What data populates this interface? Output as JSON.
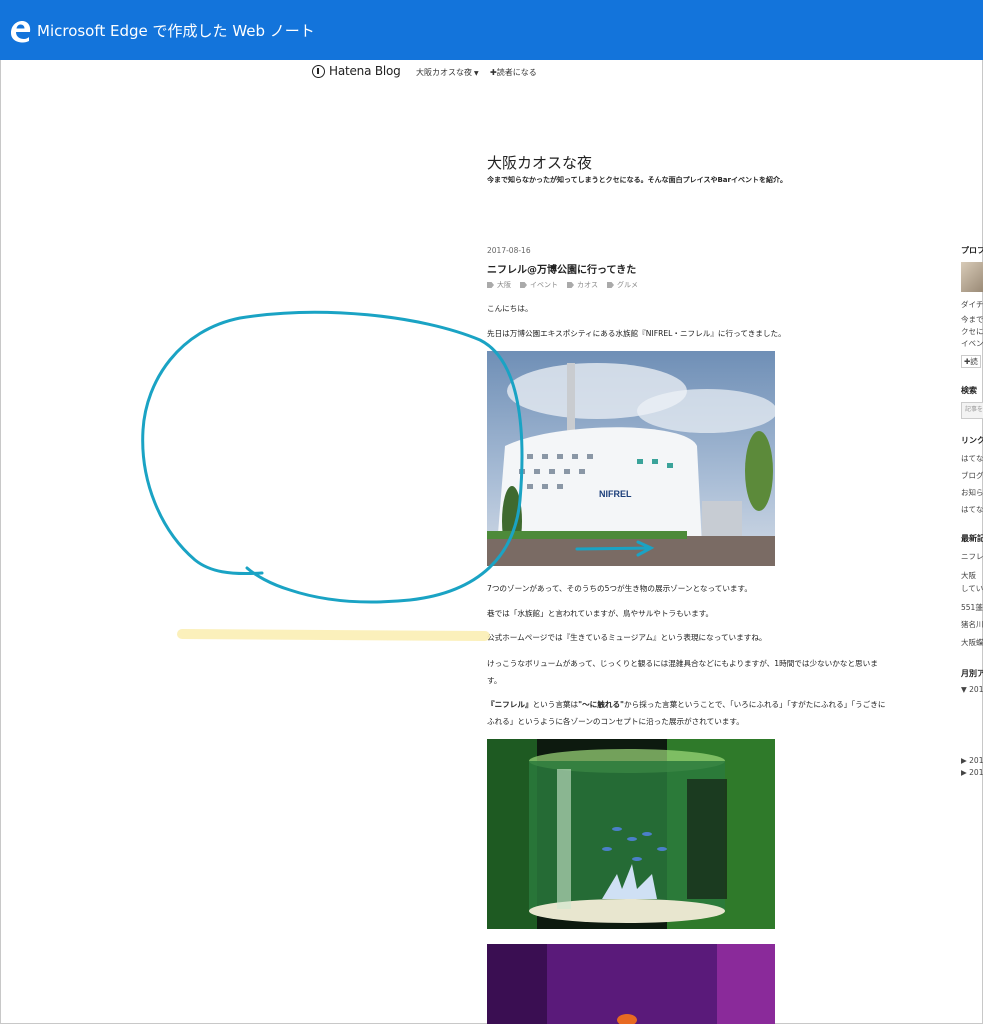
{
  "edge": {
    "title": "Microsoft Edge で作成した Web ノート",
    "logo_icon": "edge-logo-icon",
    "accent": "#1374db"
  },
  "hatena": {
    "logo_text": "Hatena Blog",
    "blog_menu": "大阪カオスな夜",
    "reader_button": "読者になる"
  },
  "blog": {
    "title": "大阪カオスな夜",
    "description": "今まで知らなかったが知ってしまうとクセになる。そんな面白プレイスやBarイベントを紹介。"
  },
  "post": {
    "date": "2017-08-16",
    "title": "ニフレル@万博公園に行ってきた",
    "tags": [
      "大阪",
      "イベント",
      "カオス",
      "グルメ"
    ],
    "p1": "こんにちは。",
    "p2": "先日は万博公園エキスポシティにある水族館『NIFREL・ニフレル』に行ってきました。",
    "p3": "7つのゾーンがあって、そのうちの5つが生き物の展示ゾーンとなっています。",
    "p4": "巷では「水族館」と言われていますが、鳥やサルやトラもいます。",
    "p5": "公式ホームページでは『生きているミュージアム』という表現になっていますね。",
    "p6": "けっこうなボリュームがあって、じっくりと観るには混雑具合などにもよりますが、1時間では少ないかなと思います。",
    "p7_bold1": "『ニフレル』",
    "p7_a": "という言葉は",
    "p7_bold2": "\"〜に触れる\"",
    "p7_b": "から採った言葉ということで、「いろにふれる」「すがたにふれる」「うごきにふれる」というように各ゾーンのコンセプトに沿った展示がされています。",
    "building_sign": "NIFREL"
  },
  "sidebar": {
    "profile": "プロフ",
    "name": "ダイチ",
    "bio1": "今まで",
    "bio2": "クセに",
    "bio3": "イベン",
    "reader": "読",
    "search": "検索",
    "search_placeholder": "記事を",
    "links": "リンク",
    "link1": "はてな",
    "link2": "ブログ",
    "link3": "お知ら",
    "link4": "はてな",
    "recent": "最新記",
    "recent1": "ニフレ",
    "recent2": "大阪",
    "recent3": "してい",
    "recent4": "551蓬",
    "recent5": "猪名川",
    "recent6": "大阪蝶",
    "archive": "月別ア",
    "arch1": "▼ 201",
    "arch2": "▶ 201",
    "arch3": "▶ 201"
  },
  "annotations": {
    "ink_color": "#1aa3c4",
    "highlight_color": "#fbeeb4"
  }
}
